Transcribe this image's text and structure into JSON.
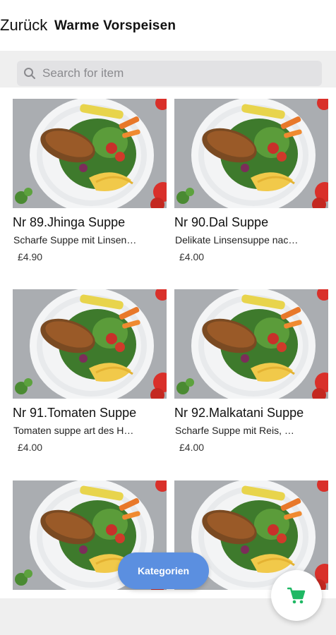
{
  "header": {
    "back_label": "Zurück",
    "title": "Warme Vorspeisen"
  },
  "search": {
    "placeholder": "Search for item",
    "value": "",
    "icon": "search-icon"
  },
  "items": [
    {
      "name": "Nr 89.Jhinga Suppe",
      "description": "Scharfe Suppe mit Linsen…",
      "price": "£4.90"
    },
    {
      "name": "Nr 90.Dal Suppe",
      "description": "Delikate Linsensuppe nac…",
      "price": "£4.00"
    },
    {
      "name": "Nr 91.Tomaten Suppe",
      "description": "Tomaten suppe art des H…",
      "price": "£4.00"
    },
    {
      "name": "Nr 92.Malkatani Suppe",
      "description": "Scharfe Suppe mit Reis, …",
      "price": "£4.00"
    },
    {
      "name": "",
      "description": "",
      "price": ""
    },
    {
      "name": "",
      "description": "",
      "price": ""
    }
  ],
  "categories_button": {
    "label": "Kategorien"
  },
  "cart_button": {
    "icon": "shopping-cart-icon",
    "color": "#1fb864"
  },
  "colors": {
    "accent": "#5b8fe0",
    "search_bg": "#e2e2e4",
    "band_bg": "#efefef"
  }
}
